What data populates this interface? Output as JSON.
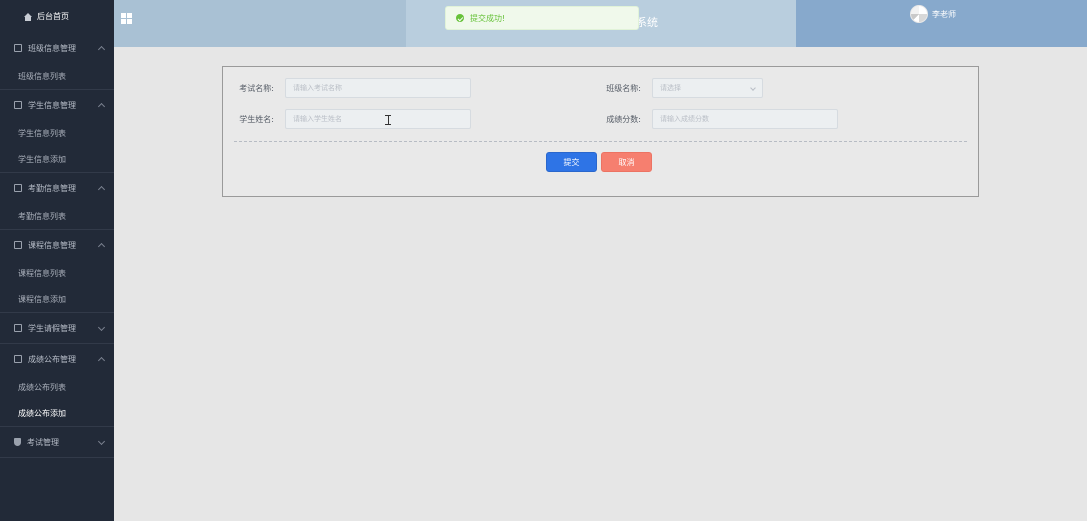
{
  "sidebar": {
    "home_label": "后台首页",
    "groups": [
      {
        "label": "班级信息管理",
        "expanded": true,
        "items": [
          "班级信息列表"
        ]
      },
      {
        "label": "学生信息管理",
        "expanded": true,
        "items": [
          "学生信息列表",
          "学生信息添加"
        ]
      },
      {
        "label": "考勤信息管理",
        "expanded": true,
        "items": [
          "考勤信息列表"
        ]
      },
      {
        "label": "课程信息管理",
        "expanded": true,
        "items": [
          "课程信息列表",
          "课程信息添加"
        ]
      },
      {
        "label": "学生请假管理",
        "expanded": false,
        "items": []
      },
      {
        "label": "成绩公布管理",
        "expanded": true,
        "items": [
          "成绩公布列表",
          "成绩公布添加"
        ]
      },
      {
        "label": "考试管理",
        "expanded": false,
        "items": []
      }
    ],
    "active_item": "成绩公布添加"
  },
  "header": {
    "title_partial": "系统",
    "user_name": "李老师"
  },
  "toast": {
    "message": "提交成功!",
    "type": "success"
  },
  "form": {
    "exam_name": {
      "label": "考试名称:",
      "placeholder": "请输入考试名称",
      "value": ""
    },
    "class_name": {
      "label": "班级名称:",
      "placeholder": "请选择",
      "value": ""
    },
    "student_name": {
      "label": "学生姓名:",
      "placeholder": "请输入学生姓名",
      "value": ""
    },
    "score": {
      "label": "成绩分数:",
      "placeholder": "请输入成绩分数",
      "value": ""
    },
    "submit_label": "提交",
    "cancel_label": "取消"
  },
  "colors": {
    "sidebar_bg": "#222a38",
    "primary": "#2e74e6",
    "danger": "#f67f6f",
    "success": "#67c23a"
  }
}
